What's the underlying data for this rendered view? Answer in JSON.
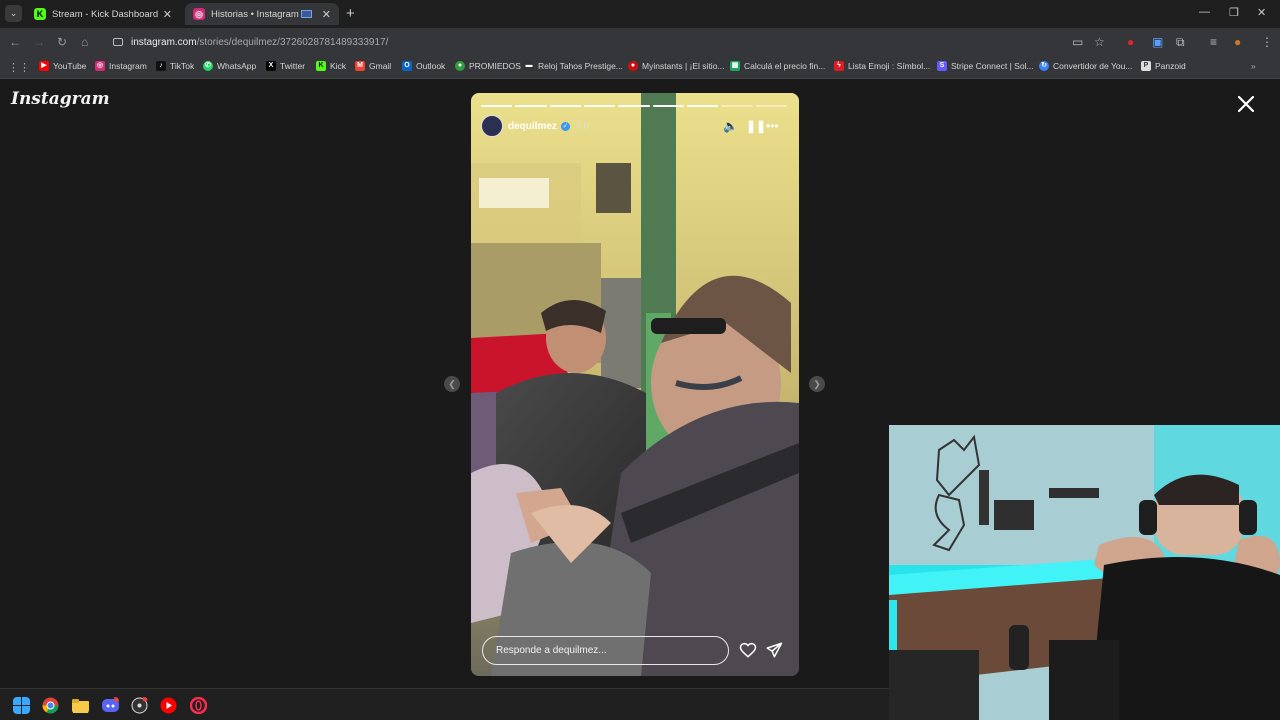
{
  "browser": {
    "tabs": [
      {
        "title": "Stream - Kick Dashboard",
        "favicon": "kick-icon",
        "color": "#53fc18"
      },
      {
        "title": "Historias • Instagram",
        "favicon": "instagram-icon",
        "color": "#d62976"
      }
    ],
    "url": {
      "domain": "instagram.com",
      "path": "/stories/dequilmez/3726028781489333917/"
    }
  },
  "bookmarks": [
    {
      "label": "YouTube",
      "icon": "youtube-icon",
      "color": "#ff0000"
    },
    {
      "label": "Instagram",
      "icon": "instagram-icon",
      "color": "#d62976"
    },
    {
      "label": "TikTok",
      "icon": "tiktok-icon",
      "color": "#111111"
    },
    {
      "label": "WhatsApp",
      "icon": "whatsapp-icon",
      "color": "#25d366"
    },
    {
      "label": "Twitter",
      "icon": "x-icon",
      "color": "#000000"
    },
    {
      "label": "Kick",
      "icon": "kick-icon",
      "color": "#53fc18"
    },
    {
      "label": "Gmail",
      "icon": "gmail-icon",
      "color": "#ea4335"
    },
    {
      "label": "Outlook",
      "icon": "outlook-icon",
      "color": "#0a64c4"
    },
    {
      "label": "PROMIEDOS",
      "icon": "promiedos-icon",
      "color": "#2e9e3e"
    },
    {
      "label": "Reloj Tahos Prestige...",
      "icon": "watch-icon",
      "color": "#333333"
    },
    {
      "label": "Myinstants | ¡El sitio...",
      "icon": "myinstants-icon",
      "color": "#cc1111"
    },
    {
      "label": "Calculá el precio fin...",
      "icon": "sheet-icon",
      "color": "#1fa463"
    },
    {
      "label": "Lista Emoji : Símbol...",
      "icon": "bolt-icon",
      "color": "#e01b24"
    },
    {
      "label": "Stripe Connect | Sol...",
      "icon": "stripe-icon",
      "color": "#635bff"
    },
    {
      "label": "Convertidor de You...",
      "icon": "converter-icon",
      "color": "#3b82f6"
    },
    {
      "label": "Panzoid",
      "icon": "panzoid-icon",
      "color": "#dddddd"
    }
  ],
  "instagram": {
    "logo": "Instagram",
    "story": {
      "username": "dequilmez",
      "time": "7 h",
      "progress_total": 9,
      "progress_done": 7,
      "reply_placeholder": "Responde a dequilmez..."
    }
  },
  "colors": {
    "page_bg": "#1a1a1a",
    "chrome_bg": "#35363a",
    "led_cyan": "#29e3ea"
  }
}
